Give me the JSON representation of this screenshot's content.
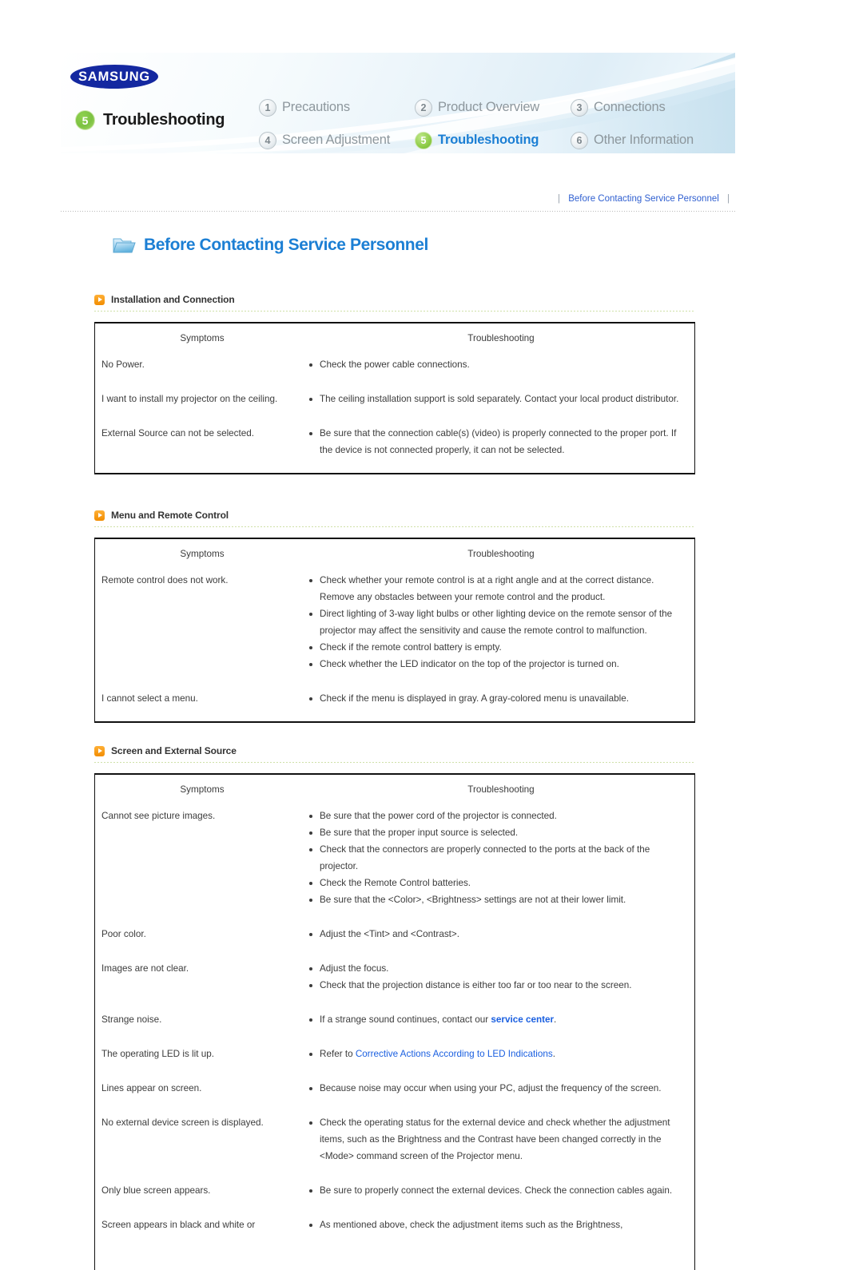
{
  "banner": {
    "brand": "SAMSUNG",
    "current": {
      "number": "5",
      "label": "Troubleshooting"
    },
    "nav": [
      {
        "number": "1",
        "label": "Precautions",
        "active": false
      },
      {
        "number": "2",
        "label": "Product Overview",
        "active": false
      },
      {
        "number": "3",
        "label": "Connections",
        "active": false
      },
      {
        "number": "4",
        "label": "Screen Adjustment",
        "active": false
      },
      {
        "number": "5",
        "label": "Troubleshooting",
        "active": true
      },
      {
        "number": "6",
        "label": "Other Information",
        "active": false
      }
    ]
  },
  "breadcrumb": {
    "separator": "|",
    "text": "Before Contacting Service Personnel"
  },
  "page": {
    "title": "Before Contacting Service Personnel",
    "folder_icon": "folder-icon"
  },
  "table_headers": {
    "symptoms": "Symptoms",
    "troubleshooting": "Troubleshooting"
  },
  "sections": [
    {
      "title": "Installation and Connection",
      "icon": "orange-arrow-icon",
      "rows": [
        {
          "symptom": "No Power.",
          "items": [
            [
              {
                "t": "Check the power cable connections."
              }
            ]
          ]
        },
        {
          "symptom": "I want to install my projector on the ceiling.",
          "items": [
            [
              {
                "t": "The ceiling installation support is sold separately. Contact your local product distributor."
              }
            ]
          ]
        },
        {
          "symptom": "External Source can not be selected.",
          "items": [
            [
              {
                "t": "Be sure that the connection cable(s) (video) is properly connected to the proper port. If the device is not connected properly, it can not be selected."
              }
            ]
          ]
        }
      ]
    },
    {
      "title": "Menu and Remote Control",
      "icon": "orange-arrow-icon",
      "rows": [
        {
          "symptom": "Remote control does not work.",
          "items": [
            [
              {
                "t": "Check whether your remote control is at a right angle and at the correct distance. Remove any obstacles between your remote control and the product."
              }
            ],
            [
              {
                "t": "Direct lighting of 3-way light bulbs or other lighting device on the remote sensor of the projector may affect the sensitivity and cause the remote control to malfunction."
              }
            ],
            [
              {
                "t": "Check if the remote control battery is empty."
              }
            ],
            [
              {
                "t": "Check whether the LED indicator on the top of the projector is turned on."
              }
            ]
          ]
        },
        {
          "symptom": "I cannot select a menu.",
          "items": [
            [
              {
                "t": "Check if the menu is displayed in gray. A gray-colored menu is unavailable."
              }
            ]
          ]
        }
      ]
    },
    {
      "title": "Screen and External Source",
      "icon": "orange-arrow-icon",
      "rows": [
        {
          "symptom": "Cannot see picture images.",
          "items": [
            [
              {
                "t": "Be sure that the power cord of the projector is connected."
              }
            ],
            [
              {
                "t": "Be sure that the proper input source is selected."
              }
            ],
            [
              {
                "t": "Check that the connectors are properly connected to the ports at the back of the projector."
              }
            ],
            [
              {
                "t": "Check the Remote Control batteries."
              }
            ],
            [
              {
                "t": "Be sure that the <Color>, <Brightness> settings are not at their lower limit."
              }
            ]
          ]
        },
        {
          "symptom": "Poor color.",
          "items": [
            [
              {
                "t": "Adjust the <Tint> and <Contrast>."
              }
            ]
          ]
        },
        {
          "symptom": "Images are not clear.",
          "items": [
            [
              {
                "t": "Adjust the focus."
              }
            ],
            [
              {
                "t": "Check that the projection distance is either too far or too near to the screen."
              }
            ]
          ]
        },
        {
          "symptom": "Strange noise.",
          "items": [
            [
              {
                "t": "If a strange sound continues, contact our "
              },
              {
                "t": "service center",
                "link": true,
                "bold": true
              },
              {
                "t": "."
              }
            ]
          ]
        },
        {
          "symptom": "The operating LED is lit up.",
          "items": [
            [
              {
                "t": "Refer to "
              },
              {
                "t": "Corrective Actions According to LED Indications",
                "link": true
              },
              {
                "t": "."
              }
            ]
          ]
        },
        {
          "symptom": "Lines appear on screen.",
          "items": [
            [
              {
                "t": "Because noise may occur when using your PC, adjust the frequency of the screen."
              }
            ]
          ]
        },
        {
          "symptom": "No external device screen is displayed.",
          "items": [
            [
              {
                "t": "Check the operating status for the external device and check whether the adjustment items, such as the Brightness and the Contrast have been changed correctly in the <Mode> command screen of the Projector menu."
              }
            ]
          ]
        },
        {
          "symptom": "Only blue screen appears.",
          "items": [
            [
              {
                "t": "Be sure to properly connect the external devices. Check the connection cables again."
              }
            ]
          ]
        },
        {
          "symptom": "Screen appears in black and white or",
          "items": [
            [
              {
                "t": "As mentioned above, check the adjustment items such as the Brightness,"
              }
            ]
          ]
        }
      ]
    }
  ]
}
